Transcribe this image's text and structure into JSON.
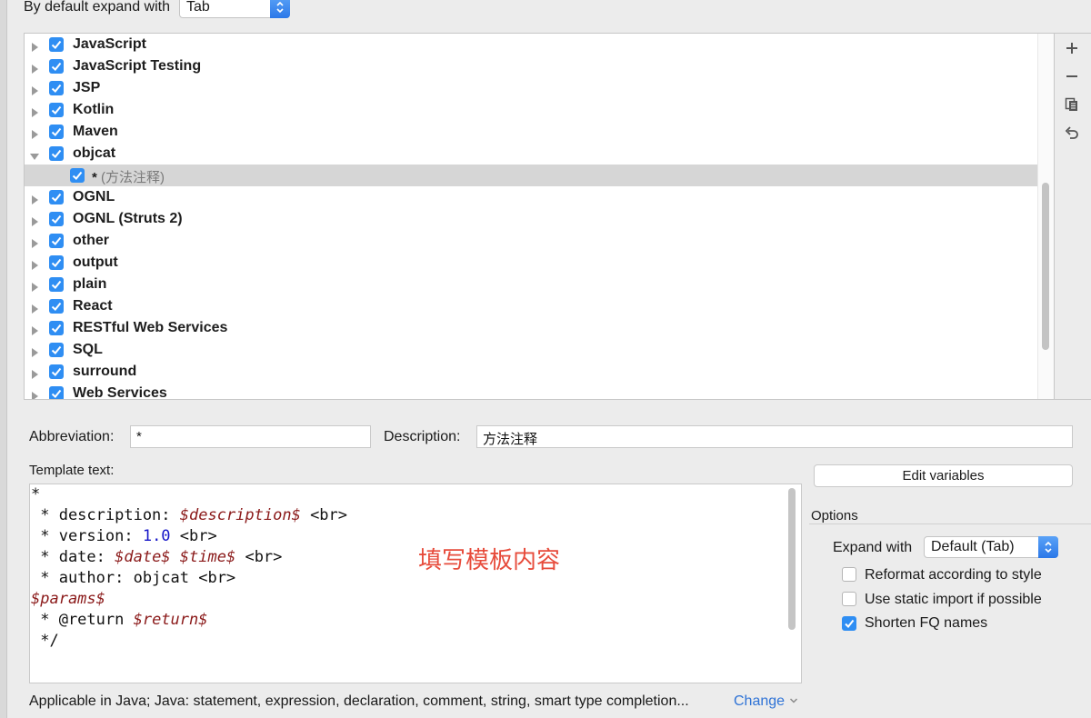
{
  "header": {
    "expand_label": "By default expand with",
    "expand_value": "Tab"
  },
  "tree": {
    "items": [
      {
        "label": "JavaScript",
        "checked": true,
        "expanded": false
      },
      {
        "label": "JavaScript Testing",
        "checked": true,
        "expanded": false
      },
      {
        "label": "JSP",
        "checked": true,
        "expanded": false
      },
      {
        "label": "Kotlin",
        "checked": true,
        "expanded": false
      },
      {
        "label": "Maven",
        "checked": true,
        "expanded": false
      },
      {
        "label": "objcat",
        "checked": true,
        "expanded": true
      },
      {
        "label": "OGNL",
        "checked": true,
        "expanded": false
      },
      {
        "label": "OGNL (Struts 2)",
        "checked": true,
        "expanded": false
      },
      {
        "label": "other",
        "checked": true,
        "expanded": false
      },
      {
        "label": "output",
        "checked": true,
        "expanded": false
      },
      {
        "label": "plain",
        "checked": true,
        "expanded": false
      },
      {
        "label": "React",
        "checked": true,
        "expanded": false
      },
      {
        "label": "RESTful Web Services",
        "checked": true,
        "expanded": false
      },
      {
        "label": "SQL",
        "checked": true,
        "expanded": false
      },
      {
        "label": "surround",
        "checked": true,
        "expanded": false
      },
      {
        "label": "Web Services",
        "checked": true,
        "expanded": false
      }
    ],
    "child": {
      "abbr": "*",
      "desc": "(方法注释)",
      "checked": true
    }
  },
  "tools": {
    "add_icon": "plus-icon",
    "remove_icon": "minus-icon",
    "copy_icon": "copy-icon",
    "restore_icon": "undo-icon"
  },
  "form": {
    "abbreviation_label": "Abbreviation:",
    "abbreviation_value": "*",
    "description_label": "Description:",
    "description_value": "方法注释",
    "template_label": "Template text:"
  },
  "template": {
    "lines": [
      "*",
      " * description: $description$ <br>",
      " * version: 1.0 <br>",
      " * date: $date$ $time$ <br>",
      " * author: objcat <br>",
      "$params$",
      " * @return $return$",
      " */"
    ],
    "annotation": "填写模板内容"
  },
  "options": {
    "edit_variables": "Edit variables",
    "title": "Options",
    "expand_with_label": "Expand with",
    "expand_with_value": "Default (Tab)",
    "reformat": {
      "label": "Reformat according to style",
      "checked": false
    },
    "static_import": {
      "label": "Use static import if possible",
      "checked": false
    },
    "shorten_fq": {
      "label": "Shorten FQ names",
      "checked": true
    }
  },
  "footer": {
    "applicable": "Applicable in Java; Java: statement, expression, declaration, comment, string, smart type completion...",
    "change": "Change"
  },
  "colors": {
    "accent": "#2f8ef3",
    "annotation": "#e74c3c",
    "variable": "#8b1a1a",
    "number": "#1515c8",
    "link": "#2f73d6"
  }
}
